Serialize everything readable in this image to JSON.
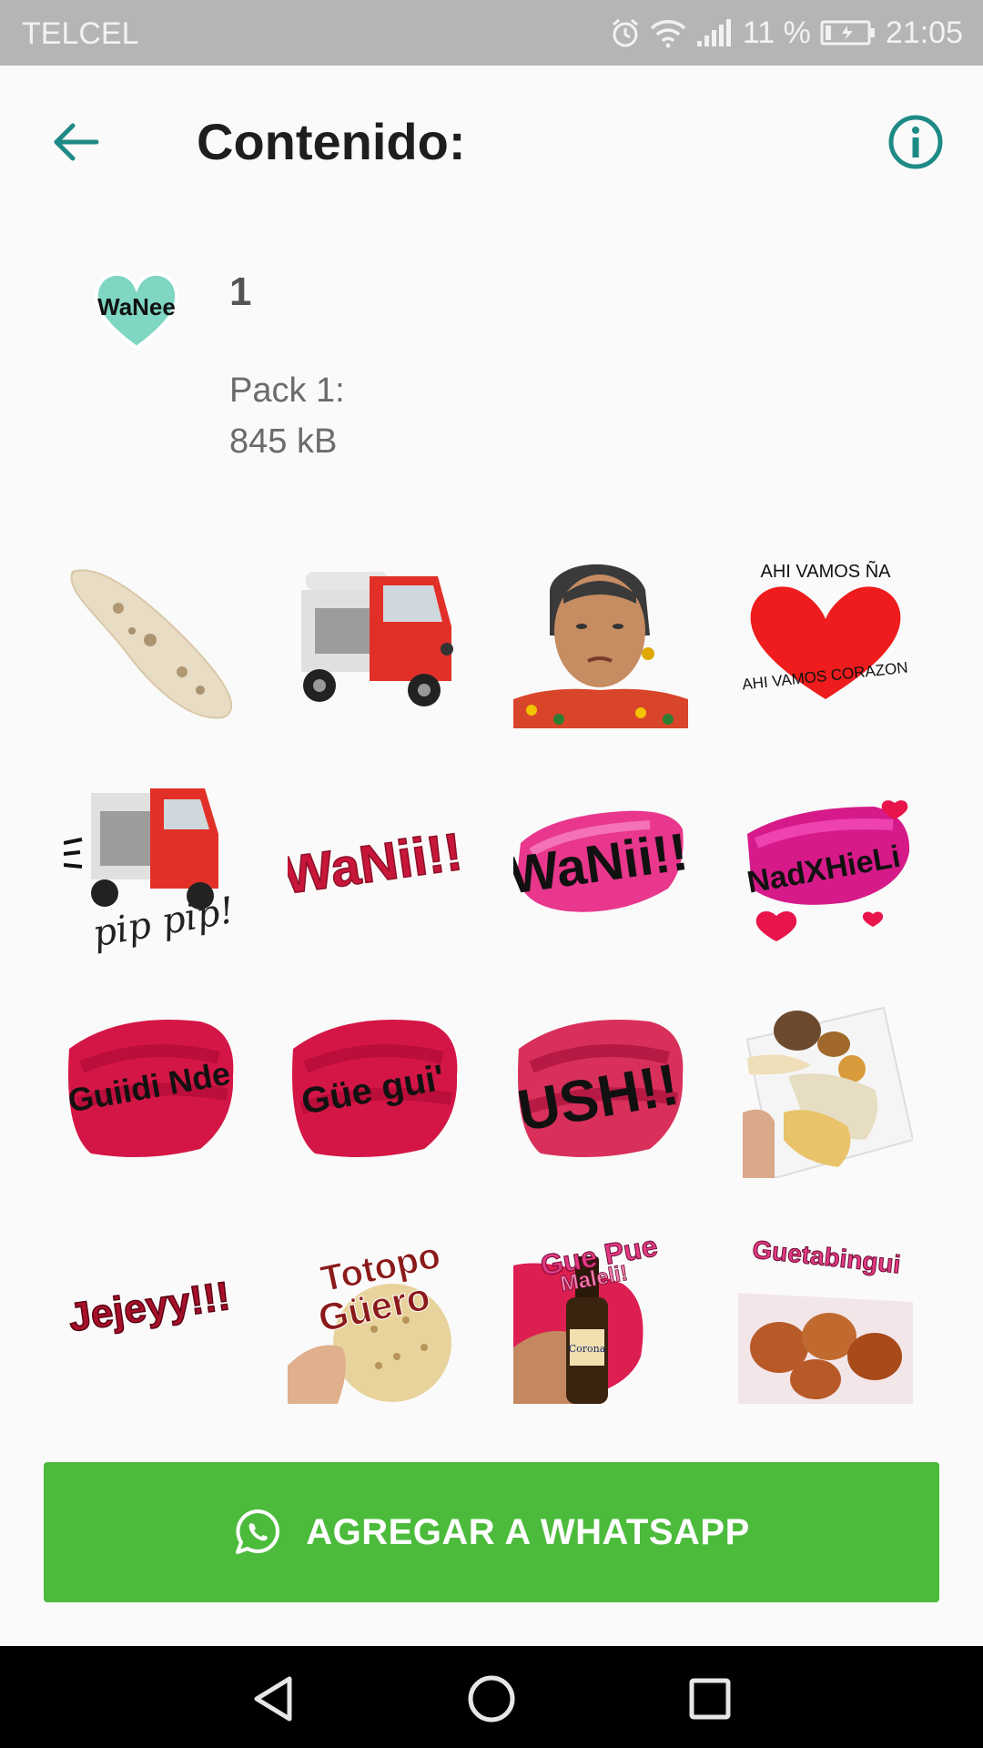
{
  "status_bar": {
    "carrier": "TELCEL",
    "battery_text": "11 %",
    "time": "21:05",
    "icons": [
      "alarm-icon",
      "wifi-icon",
      "signal-icon",
      "battery-icon"
    ]
  },
  "app_bar": {
    "title": "Contenido:",
    "back_icon": "arrow-left-icon",
    "info_icon": "info-icon",
    "accent_color": "#1e8a86"
  },
  "pack": {
    "tray_text": "WaNee",
    "name": "1",
    "publisher": "Pack 1:",
    "size": "845 kB"
  },
  "stickers": [
    {
      "name": "tortilla-sticker"
    },
    {
      "name": "mototaxi-sticker"
    },
    {
      "name": "woman-photo-sticker"
    },
    {
      "name": "heart-sticker",
      "texts": [
        "AHI VAMOS ÑA",
        "AHI VAMOS CORAZON"
      ]
    },
    {
      "name": "mototaxi-pip-sticker",
      "texts": [
        "pip pip!"
      ]
    },
    {
      "name": "wanii-red-sticker",
      "texts": [
        "WaNii!!"
      ]
    },
    {
      "name": "wanii-pink-sticker",
      "texts": [
        "WaNii!!"
      ]
    },
    {
      "name": "nadxhieli-sticker",
      "texts": [
        "NadXHieLi"
      ]
    },
    {
      "name": "guiidi-nde-sticker",
      "texts": [
        "Guiidi Nde"
      ]
    },
    {
      "name": "gue-gui-sticker",
      "texts": [
        "Güe gui'"
      ]
    },
    {
      "name": "ush-sticker",
      "texts": [
        "USH!!"
      ]
    },
    {
      "name": "food-plate-sticker"
    },
    {
      "name": "jejeyy-sticker",
      "texts": [
        "Jejeyy!!!"
      ]
    },
    {
      "name": "totopo-guero-sticker",
      "texts": [
        "Totopo",
        "Güero"
      ]
    },
    {
      "name": "gue-pue-maleli-sticker",
      "texts": [
        "Gue Pue",
        "Maleli!"
      ]
    },
    {
      "name": "guetabingui-sticker",
      "texts": [
        "Guetabingui"
      ]
    }
  ],
  "add_button": {
    "label": "AGREGAR A WHATSAPP",
    "icon": "whatsapp-icon",
    "color": "#4cbb3c"
  },
  "nav_bar": {
    "icons": [
      "back-triangle-icon",
      "home-circle-icon",
      "recents-square-icon"
    ]
  }
}
